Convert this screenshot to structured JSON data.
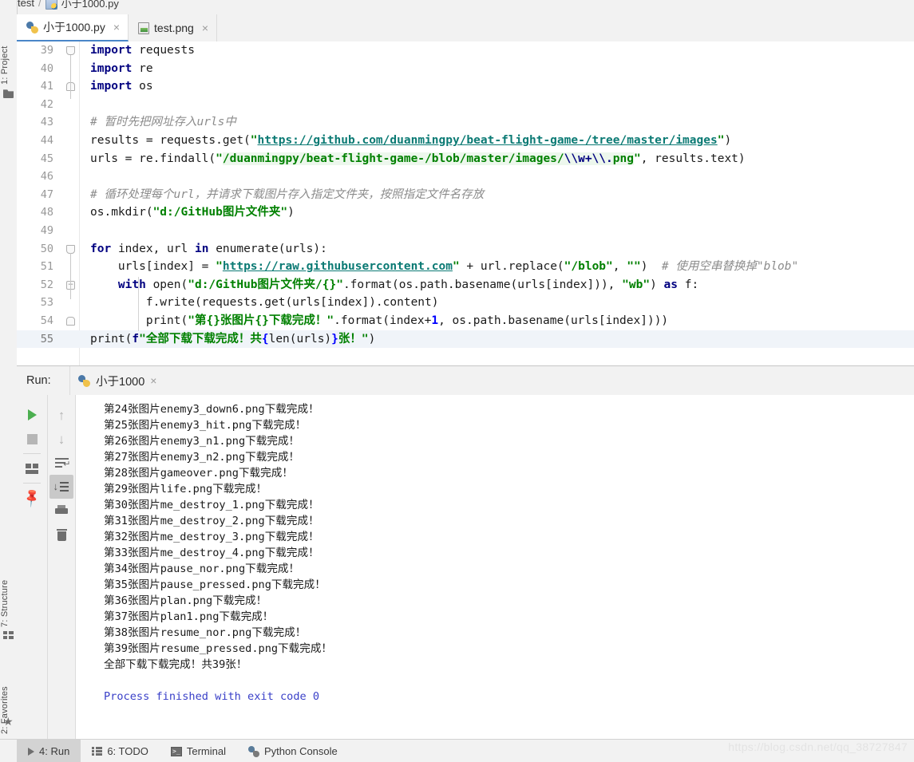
{
  "breadcrumb": {
    "project": "test",
    "separator": "/",
    "file": "小于1000.py"
  },
  "left_strip": {
    "project": "1: Project",
    "structure": "7: Structure",
    "favorites": "2: Favorites"
  },
  "tabs": [
    {
      "label": "小于1000.py",
      "icon": "python-file-icon",
      "close": "×",
      "active": true
    },
    {
      "label": "test.png",
      "icon": "image-file-icon",
      "close": "×",
      "active": false
    }
  ],
  "editor": {
    "lines": [
      {
        "n": "39",
        "fold": "top",
        "html": "<span class='kw'>import</span> <span class='plain'>requests</span>"
      },
      {
        "n": "40",
        "fold": "",
        "html": "<span class='kw'>import</span> <span class='plain'>re</span>"
      },
      {
        "n": "41",
        "fold": "bot",
        "html": "<span class='kw'>import</span> <span class='plain'>os</span>"
      },
      {
        "n": "42",
        "fold": "",
        "html": ""
      },
      {
        "n": "43",
        "fold": "",
        "html": "<span class='cmt'># 暂时先把网址存入urls中</span>"
      },
      {
        "n": "44",
        "fold": "",
        "html": "<span class='plain'>results = requests.get(</span><span class='str'>\"</span><span class='url'>https://github.com/duanmingpy/beat-flight-game-/tree/master/images</span><span class='str'>\"</span><span class='plain'>)</span>"
      },
      {
        "n": "45",
        "fold": "",
        "html": "<span class='plain'>urls = re.findall(</span><span class='str'>\"</span><span class='re-hl'><span class='str'>/duanmingpy/beat-flight-game-/blob/master/images/</span><span class='esc'>\\\\w+\\\\.</span><span class='str'>png</span></span><span class='str'>\"</span><span class='plain'>, results.text)</span>"
      },
      {
        "n": "46",
        "fold": "",
        "html": ""
      },
      {
        "n": "47",
        "fold": "",
        "html": "<span class='cmt'># 循环处理每个url，并请求下载图片存入指定文件夹，按照指定文件名存放</span>"
      },
      {
        "n": "48",
        "fold": "",
        "html": "<span class='plain'>os.mkdir(</span><span class='str'>\"d:/GitHub图片文件夹\"</span><span class='plain'>)</span>"
      },
      {
        "n": "49",
        "fold": "",
        "html": ""
      },
      {
        "n": "50",
        "fold": "top",
        "html": "<span class='kw'>for</span> <span class='plain'>index, url</span> <span class='kw'>in</span> <span class='plain'>enumerate(urls):</span>"
      },
      {
        "n": "51",
        "fold": "",
        "html": "    <span class='plain'>urls[index] = </span><span class='str'>\"</span><span class='url'>https://raw.githubusercontent.com</span><span class='str'>\"</span><span class='plain'> + url.replace(</span><span class='str'>\"/blob\"</span><span class='plain'>, </span><span class='str'>\"\"</span><span class='plain'>)</span>  <span class='cmt'># 使用空串替换掉\"blob\"</span>"
      },
      {
        "n": "52",
        "fold": "sq",
        "html": "    <span class='kw'>with</span> <span class='plain'>open(</span><span class='str'>\"d:/GitHub图片文件夹/{}\"</span><span class='plain'>.format(os.path.basename(urls[index])), </span><span class='str'>\"wb\"</span><span class='plain'>) </span><span class='kw'>as</span> <span class='plain'>f:</span>"
      },
      {
        "n": "53",
        "fold": "",
        "html": "        <span class='plain'>f.write(requests.get(urls[index]).content)</span>"
      },
      {
        "n": "54",
        "fold": "bot",
        "html": "        <span class='plain'>print(</span><span class='str'>\"第{}张图片{}下载完成！\"</span><span class='plain'>.format(index+</span><span class='num'>1</span><span class='plain'>, os.path.basename(urls[index])))</span>"
      },
      {
        "n": "55",
        "fold": "",
        "caret": true,
        "html": "<span class='plain'>print(</span><span class='kw'>f</span><span class='str'>\"全部下载下载完成！共</span><span class='num'>{</span><span class='plain'>len(urls)</span><span class='num'>}</span><span class='str'>张！\"</span><span class='plain'>)</span>"
      }
    ]
  },
  "run_panel": {
    "label": "Run:",
    "tab_label": "小于1000",
    "tab_close": "×",
    "toolbar_primary": [
      {
        "name": "rerun-button",
        "icon": "play-icon"
      },
      {
        "name": "stop-button",
        "icon": "stop-square-icon"
      },
      {
        "name": "layout-button",
        "icon": "layout-icon"
      },
      {
        "name": "pin-tab-button",
        "icon": "pin-icon"
      }
    ],
    "toolbar_secondary": [
      {
        "name": "prev-occurrence-button",
        "icon": "arrow-up-icon",
        "glyph": "↑"
      },
      {
        "name": "next-occurrence-button",
        "icon": "arrow-down-icon",
        "glyph": "↓"
      },
      {
        "name": "soft-wrap-button",
        "icon": "soft-wrap-icon"
      },
      {
        "name": "scroll-to-end-button",
        "icon": "scroll-to-end-icon",
        "selected": true
      },
      {
        "name": "print-button",
        "icon": "print-icon"
      },
      {
        "name": "clear-all-button",
        "icon": "trash-icon"
      }
    ],
    "console_lines": [
      {
        "text": "第24张图片enemy3_down6.png下载完成！",
        "style": "normal"
      },
      {
        "text": "第25张图片enemy3_hit.png下载完成！",
        "style": "normal"
      },
      {
        "text": "第26张图片enemy3_n1.png下载完成！",
        "style": "normal"
      },
      {
        "text": "第27张图片enemy3_n2.png下载完成！",
        "style": "normal"
      },
      {
        "text": "第28张图片gameover.png下载完成！",
        "style": "normal"
      },
      {
        "text": "第29张图片life.png下载完成！",
        "style": "normal"
      },
      {
        "text": "第30张图片me_destroy_1.png下载完成！",
        "style": "normal"
      },
      {
        "text": "第31张图片me_destroy_2.png下载完成！",
        "style": "normal"
      },
      {
        "text": "第32张图片me_destroy_3.png下载完成！",
        "style": "normal"
      },
      {
        "text": "第33张图片me_destroy_4.png下载完成！",
        "style": "normal"
      },
      {
        "text": "第34张图片pause_nor.png下载完成！",
        "style": "normal"
      },
      {
        "text": "第35张图片pause_pressed.png下载完成！",
        "style": "normal"
      },
      {
        "text": "第36张图片plan.png下载完成！",
        "style": "normal"
      },
      {
        "text": "第37张图片plan1.png下载完成！",
        "style": "normal"
      },
      {
        "text": "第38张图片resume_nor.png下载完成！",
        "style": "normal"
      },
      {
        "text": "第39张图片resume_pressed.png下载完成！",
        "style": "normal"
      },
      {
        "text": "全部下载下载完成！共39张！",
        "style": "normal"
      },
      {
        "text": "",
        "style": "normal"
      },
      {
        "text": "Process finished with exit code 0",
        "style": "info"
      }
    ]
  },
  "status_bar": [
    {
      "label": "4: Run",
      "underline": "4",
      "rest": ": Run",
      "icon": "play-icon",
      "active": true
    },
    {
      "label": "6: TODO",
      "underline": "6",
      "rest": ": TODO",
      "icon": "todo-list-icon",
      "active": false
    },
    {
      "label": "Terminal",
      "underline": "",
      "rest": "Terminal",
      "icon": "terminal-icon",
      "active": false
    },
    {
      "label": "Python Console",
      "underline": "",
      "rest": "Python Console",
      "icon": "python-icon",
      "active": false
    }
  ],
  "watermark": "https://blog.csdn.net/qq_38727847",
  "colors": {
    "accent": "#4a86c8",
    "keyword": "#000080",
    "string": "#008000",
    "url": "#0b7a74",
    "comment": "#8c8c8c",
    "number": "#0000ff",
    "console_info": "#3a40c8",
    "panel_bg": "#f2f2f2"
  }
}
